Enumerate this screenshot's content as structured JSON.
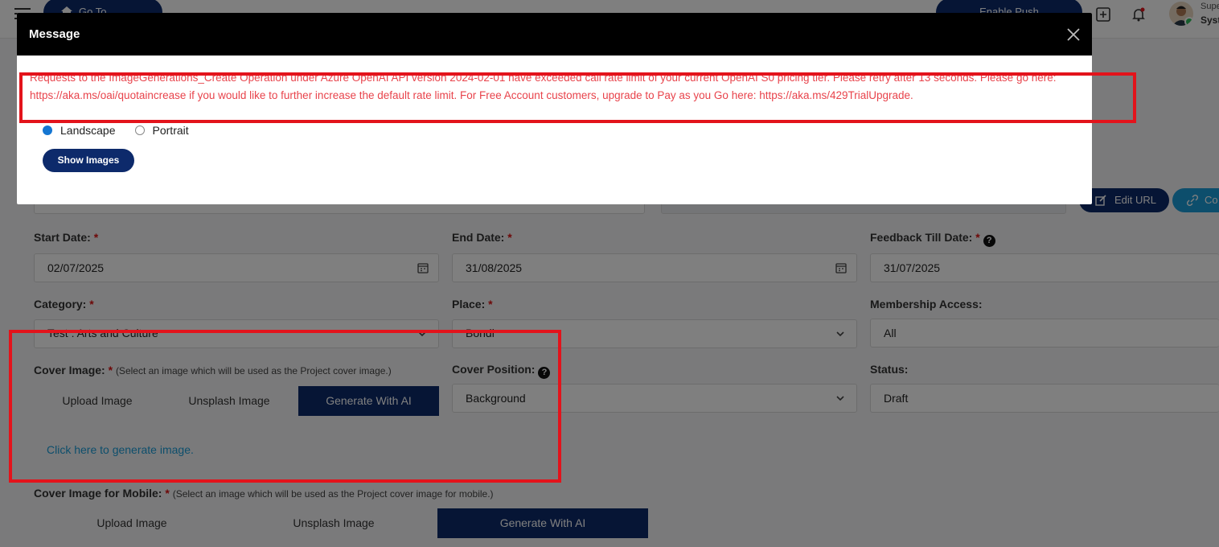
{
  "topbar": {
    "go_to_website": "Go To Website",
    "enable_push": "Enable Push Notifications",
    "user_role": "Super",
    "user_name": "Syst"
  },
  "actions": {
    "edit_url": "Edit URL",
    "copy_partial": "Co"
  },
  "form": {
    "start_date_label": "Start Date:",
    "start_date_value": "02/07/2025",
    "end_date_label": "End Date:",
    "end_date_value": "31/08/2025",
    "feedback_label": "Feedback Till Date:",
    "feedback_value": "31/07/2025",
    "category_label": "Category:",
    "category_value": "Test : Arts and Culture",
    "place_label": "Place:",
    "place_value": "Bondi",
    "membership_label": "Membership Access:",
    "membership_value": "All",
    "cover_image_label": "Cover Image:",
    "cover_image_hint": "(Select an image which will be used as the Project cover image.)",
    "cover_position_label": "Cover Position:",
    "cover_position_value": "Background",
    "status_label": "Status:",
    "status_value": "Draft",
    "upload_image": "Upload Image",
    "unsplash_image": "Unsplash Image",
    "generate_ai": "Generate With AI",
    "generate_link": "Click here to generate image.",
    "cover_mobile_label": "Cover Image for Mobile:",
    "cover_mobile_hint": "(Select an image which will be used as the Project cover image for mobile.)",
    "required_mark": "*"
  },
  "modal": {
    "title": "Message",
    "error": "Requests to the ImageGenerations_Create Operation under Azure OpenAI API version 2024-02-01 have exceeded call rate limit of your current OpenAI S0 pricing tier. Please retry after 13 seconds. Please go here: https://aka.ms/oai/quotaincrease if you would like to further increase the default rate limit. For Free Account customers, upgrade to Pay as you Go here: https://aka.ms/429TrialUpgrade.",
    "orientation_options": [
      "Landscape",
      "Portrait"
    ],
    "selected_orientation": "Landscape",
    "show_images": "Show Images"
  },
  "colors": {
    "brand_navy": "#0d2a6b",
    "error_text": "#e8434b",
    "annotation_red": "#e3131b",
    "link": "#1a9dd8"
  }
}
